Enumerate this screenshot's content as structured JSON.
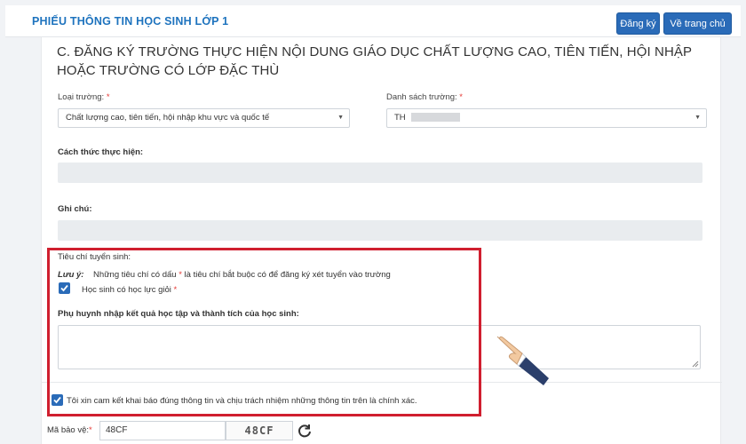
{
  "header": {
    "title": "PHIẾU THÔNG TIN HỌC SINH LỚP 1",
    "register_label": "Đăng ký",
    "home_label": "Về trang chủ"
  },
  "section": {
    "title": "C. ĐĂNG KÝ TRƯỜNG THỰC HIỆN NỘI DUNG GIÁO DỤC CHẤT LƯỢNG CAO, TIÊN TIẾN, HỘI NHẬP HOẶC TRƯỜNG CÓ LỚP ĐẶC THÙ"
  },
  "form": {
    "school_type_label": "Loại trường:",
    "school_type_value": "Chất lượng cao, tiên tiến, hội nhập khu vực và quốc tế",
    "school_list_label": "Danh sách trường:",
    "school_list_value": "TH",
    "method_label": "Cách thức thực hiện:",
    "note_label": "Ghi chú:",
    "required_mark": "*"
  },
  "criteria": {
    "title": "Tiêu chí tuyển sinh:",
    "note_prefix": "Lưu ý:",
    "note_text_before": "Những tiêu chí có dấu",
    "note_text_after": "là tiêu chí bắt buộc có để đăng ký xét tuyển vào trường",
    "good_student_label": "Học sinh có học lực giỏi",
    "good_student_checked": true,
    "parent_input_label": "Phụ huynh nhập kết quả học tập và thành tích của học sinh:",
    "parent_input_value": ""
  },
  "commitment": {
    "label": "Tôi xin cam kết khai báo đúng thông tin và chịu trách nhiệm những thông tin trên là chính xác.",
    "checked": true
  },
  "captcha": {
    "label": "Mã bảo vệ:",
    "input_value": "48CF",
    "image_text": "48CF"
  },
  "colors": {
    "accent": "#2a6bb8",
    "title": "#1e73be",
    "highlight": "#d01f2f",
    "required": "#e53935"
  }
}
